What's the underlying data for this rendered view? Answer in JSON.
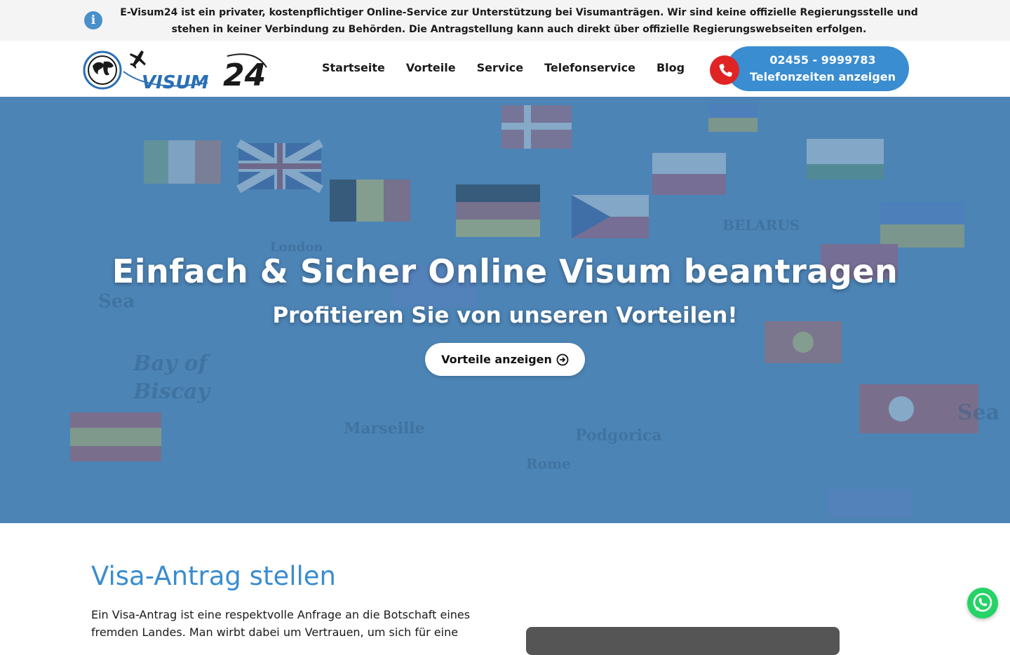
{
  "notice": {
    "icon": "info-icon",
    "text": "E-Visum24 ist ein privater, kostenpflichtiger Online-Service zur Unterstützung bei Visumanträgen. Wir sind keine offizielle Regierungsstelle und stehen in keiner Verbindung zu Behörden. Die Antragstellung kann auch direkt über offizielle Regierungswebseiten erfolgen."
  },
  "header": {
    "logo_text": "VISUM",
    "logo_number": "24",
    "nav": [
      {
        "label": "Startseite"
      },
      {
        "label": "Vorteile"
      },
      {
        "label": "Service"
      },
      {
        "label": "Telefonservice"
      },
      {
        "label": "Blog"
      }
    ],
    "phone": {
      "icon": "phone-icon",
      "number": "02455 - 9999783",
      "hours_label": "Telefonzeiten anzeigen"
    }
  },
  "hero": {
    "title": "Einfach & Sicher Online Visum beantragen",
    "subtitle": "Profitieren Sie von unseren Vorteilen!",
    "cta_label": "Vorteile anzeigen",
    "cta_icon": "arrow-circle-right-icon"
  },
  "content": {
    "title": "Visa-Antrag stellen",
    "text": "Ein Visa-Antrag ist eine respektvolle Anfrage an die Botschaft eines fremden Landes. Man wirbt dabei um Vertrauen, um sich für eine"
  },
  "floating": {
    "whatsapp_icon": "whatsapp-icon"
  },
  "colors": {
    "accent": "#3a8dd0",
    "phone_red": "#e02424",
    "hero_overlay": "#3f7cb0",
    "whatsapp": "#25d366"
  }
}
